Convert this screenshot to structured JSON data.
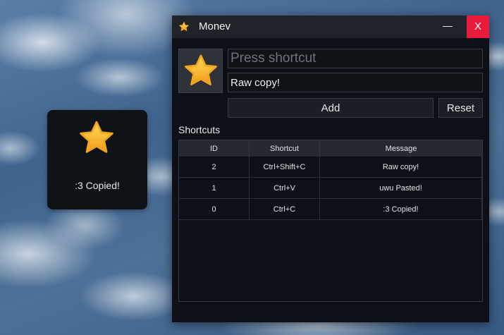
{
  "popup": {
    "icon": "star-icon",
    "message": ":3 Copied!"
  },
  "window": {
    "title": "Monev",
    "icon": "star-icon",
    "minimize_label": "—",
    "close_label": "X",
    "accent_close": "#e81b3c"
  },
  "form": {
    "shortcut_placeholder": "Press shortcut",
    "shortcut_value": "",
    "message_value": "Raw copy!",
    "add_label": "Add",
    "reset_label": "Reset"
  },
  "shortcuts": {
    "section_label": "Shortcuts",
    "columns": [
      "ID",
      "Shortcut",
      "Message"
    ],
    "rows": [
      {
        "id": "2",
        "shortcut": "Ctrl+Shift+C",
        "message": "Raw copy!"
      },
      {
        "id": "1",
        "shortcut": "Ctrl+V",
        "message": "uwu Pasted!"
      },
      {
        "id": "0",
        "shortcut": "Ctrl+C",
        "message": ":3 Copied!"
      }
    ]
  },
  "colors": {
    "star_top": "#ffd54a",
    "star_bottom": "#f5a623",
    "window_bg": "#0d1016",
    "titlebar_bg": "#20232a"
  }
}
